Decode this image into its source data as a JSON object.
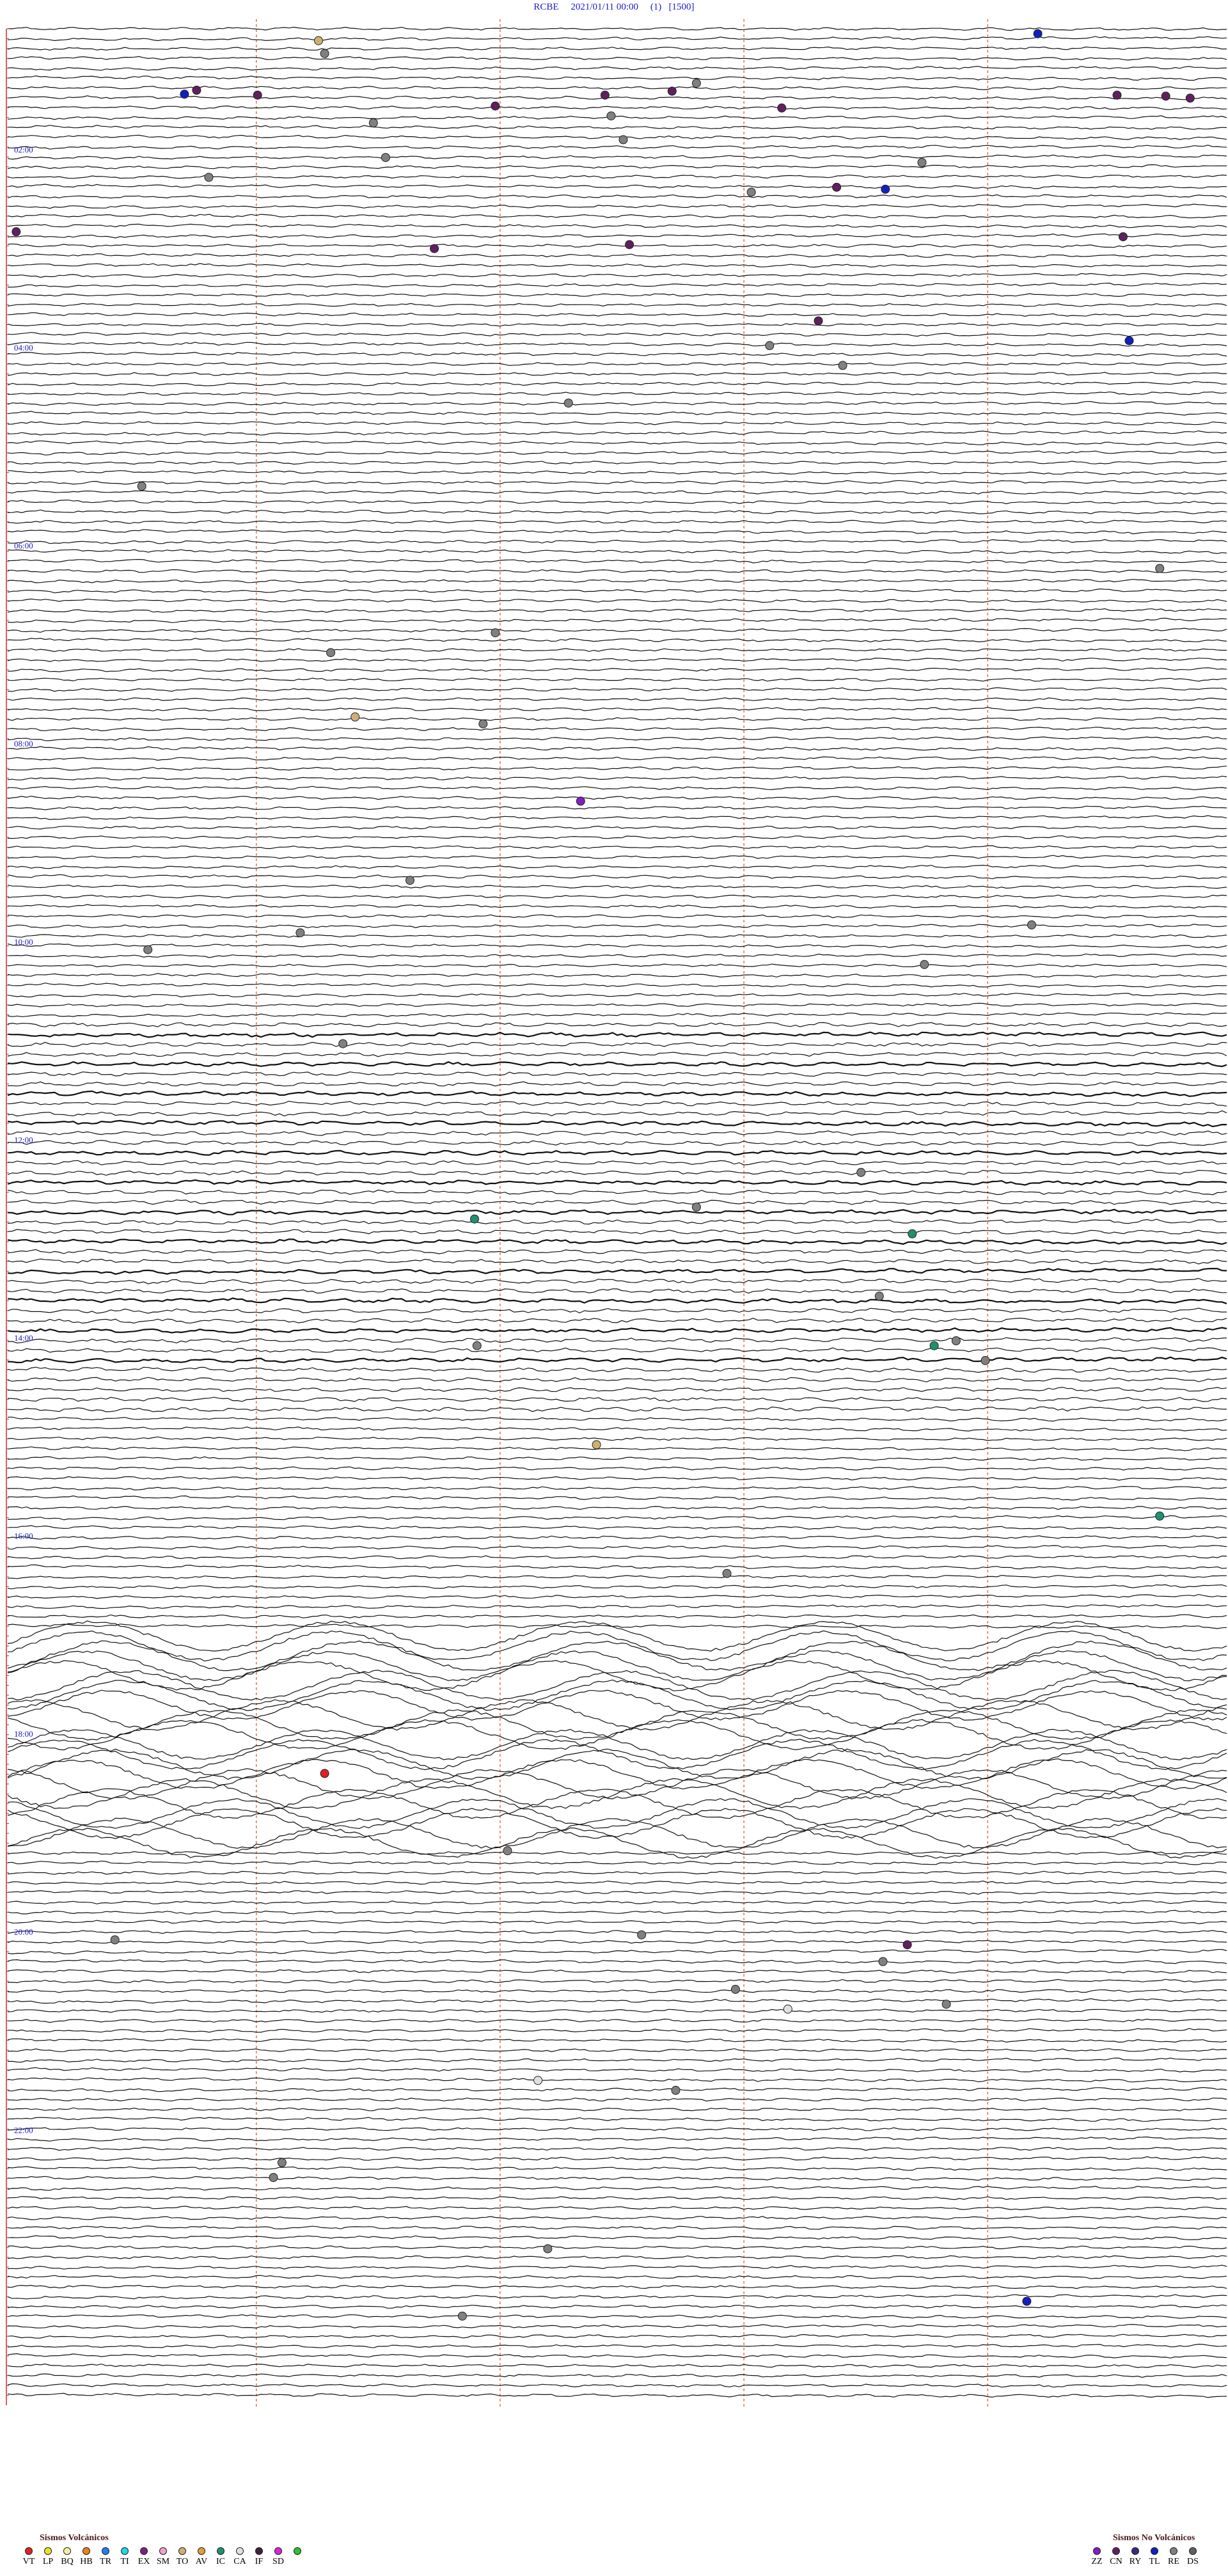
{
  "header": {
    "station": "RCBE",
    "datetime": "2021/01/11 00:00",
    "run": "(1)",
    "scale": "[1500]"
  },
  "hour_labels": [
    "02:00",
    "04:00",
    "06:00",
    "08:00",
    "10:00",
    "12:00",
    "14:00",
    "16:00",
    "18:00",
    "20:00",
    "22:00"
  ],
  "colors": {
    "trace": "#111111",
    "gridline": "#e06a3a",
    "hour_label": "#1a1acc",
    "bracket": "#c03030"
  },
  "legend_volcanic": {
    "title": "Sismos Volcánicos",
    "items": [
      {
        "code": "VT",
        "color": "#e02020"
      },
      {
        "code": "LP",
        "color": "#f0e020"
      },
      {
        "code": "BQ",
        "color": "#f8f0a0"
      },
      {
        "code": "HB",
        "color": "#f08020"
      },
      {
        "code": "TR",
        "color": "#2080f0"
      },
      {
        "code": "TI",
        "color": "#20d8e0"
      },
      {
        "code": "EX",
        "color": "#802080"
      },
      {
        "code": "SM",
        "color": "#f0a0d0"
      },
      {
        "code": "TO",
        "color": "#d0b070"
      },
      {
        "code": "AV",
        "color": "#e0a040"
      },
      {
        "code": "IC",
        "color": "#209070"
      },
      {
        "code": "CA",
        "color": "#e0e0e0"
      },
      {
        "code": "IF",
        "color": "#402040"
      },
      {
        "code": "SD",
        "color": "#e020e0"
      },
      {
        "code": "",
        "color": "#30c030"
      }
    ]
  },
  "legend_nonvolcanic": {
    "title": "Sismos No Volcánicos",
    "items": [
      {
        "code": "ZZ",
        "color": "#8020c0"
      },
      {
        "code": "CN",
        "color": "#602060"
      },
      {
        "code": "RY",
        "color": "#402880"
      },
      {
        "code": "TL",
        "color": "#1020c0"
      },
      {
        "code": "RE",
        "color": "#808080"
      },
      {
        "code": "DS",
        "color": "#606060"
      }
    ]
  },
  "events": [
    {
      "hour": 0.05,
      "x": 0.845,
      "color": "#1020c0"
    },
    {
      "hour": 0.12,
      "x": 0.255,
      "color": "#d0b070"
    },
    {
      "hour": 0.25,
      "x": 0.26,
      "color": "#808080"
    },
    {
      "hour": 0.55,
      "x": 0.565,
      "color": "#808080"
    },
    {
      "hour": 0.62,
      "x": 0.155,
      "color": "#602060"
    },
    {
      "hour": 0.66,
      "x": 0.145,
      "color": "#1020c0"
    },
    {
      "hour": 0.63,
      "x": 0.545,
      "color": "#602060"
    },
    {
      "hour": 0.67,
      "x": 0.205,
      "color": "#602060"
    },
    {
      "hour": 0.67,
      "x": 0.49,
      "color": "#602060"
    },
    {
      "hour": 0.67,
      "x": 0.91,
      "color": "#602060"
    },
    {
      "hour": 0.68,
      "x": 0.95,
      "color": "#602060"
    },
    {
      "hour": 0.7,
      "x": 0.97,
      "color": "#602060"
    },
    {
      "hour": 0.78,
      "x": 0.4,
      "color": "#602060"
    },
    {
      "hour": 0.8,
      "x": 0.635,
      "color": "#602060"
    },
    {
      "hour": 0.88,
      "x": 0.495,
      "color": "#808080"
    },
    {
      "hour": 0.95,
      "x": 0.3,
      "color": "#808080"
    },
    {
      "hour": 1.12,
      "x": 0.505,
      "color": "#808080"
    },
    {
      "hour": 1.3,
      "x": 0.31,
      "color": "#808080"
    },
    {
      "hour": 1.35,
      "x": 0.75,
      "color": "#808080"
    },
    {
      "hour": 1.5,
      "x": 0.165,
      "color": "#808080"
    },
    {
      "hour": 1.6,
      "x": 0.68,
      "color": "#602060"
    },
    {
      "hour": 1.62,
      "x": 0.72,
      "color": "#1020c0"
    },
    {
      "hour": 1.65,
      "x": 0.61,
      "color": "#808080"
    },
    {
      "hour": 2.05,
      "x": 0.007,
      "color": "#602060"
    },
    {
      "hour": 2.1,
      "x": 0.915,
      "color": "#602060"
    },
    {
      "hour": 2.18,
      "x": 0.51,
      "color": "#602060"
    },
    {
      "hour": 2.22,
      "x": 0.35,
      "color": "#602060"
    },
    {
      "hour": 2.95,
      "x": 0.665,
      "color": "#602060"
    },
    {
      "hour": 3.15,
      "x": 0.92,
      "color": "#1020c0"
    },
    {
      "hour": 3.2,
      "x": 0.625,
      "color": "#808080"
    },
    {
      "hour": 3.4,
      "x": 0.685,
      "color": "#808080"
    },
    {
      "hour": 3.78,
      "x": 0.46,
      "color": "#808080"
    },
    {
      "hour": 4.62,
      "x": 0.11,
      "color": "#808080"
    },
    {
      "hour": 5.45,
      "x": 0.945,
      "color": "#808080"
    },
    {
      "hour": 6.1,
      "x": 0.4,
      "color": "#808080"
    },
    {
      "hour": 6.3,
      "x": 0.265,
      "color": "#808080"
    },
    {
      "hour": 6.95,
      "x": 0.285,
      "color": "#d0b070"
    },
    {
      "hour": 7.02,
      "x": 0.39,
      "color": "#808080"
    },
    {
      "hour": 7.8,
      "x": 0.47,
      "color": "#8020c0"
    },
    {
      "hour": 8.6,
      "x": 0.33,
      "color": "#808080"
    },
    {
      "hour": 9.05,
      "x": 0.84,
      "color": "#808080"
    },
    {
      "hour": 9.13,
      "x": 0.24,
      "color": "#808080"
    },
    {
      "hour": 9.3,
      "x": 0.115,
      "color": "#808080"
    },
    {
      "hour": 9.45,
      "x": 0.752,
      "color": "#808080"
    },
    {
      "hour": 10.25,
      "x": 0.275,
      "color": "#808080"
    },
    {
      "hour": 11.55,
      "x": 0.7,
      "color": "#808080"
    },
    {
      "hour": 11.9,
      "x": 0.565,
      "color": "#808080"
    },
    {
      "hour": 12.02,
      "x": 0.383,
      "color": "#209070"
    },
    {
      "hour": 12.17,
      "x": 0.742,
      "color": "#209070"
    },
    {
      "hour": 12.8,
      "x": 0.715,
      "color": "#808080"
    },
    {
      "hour": 13.3,
      "x": 0.385,
      "color": "#808080"
    },
    {
      "hour": 13.3,
      "x": 0.76,
      "color": "#209070"
    },
    {
      "hour": 13.25,
      "x": 0.778,
      "color": "#808080"
    },
    {
      "hour": 13.45,
      "x": 0.802,
      "color": "#808080"
    },
    {
      "hour": 14.3,
      "x": 0.483,
      "color": "#d0b070"
    },
    {
      "hour": 15.02,
      "x": 0.945,
      "color": "#209070"
    },
    {
      "hour": 15.6,
      "x": 0.59,
      "color": "#808080"
    },
    {
      "hour": 17.62,
      "x": 0.26,
      "color": "#e02020"
    },
    {
      "hour": 18.4,
      "x": 0.41,
      "color": "#808080"
    },
    {
      "hour": 19.3,
      "x": 0.088,
      "color": "#808080"
    },
    {
      "hour": 19.25,
      "x": 0.52,
      "color": "#808080"
    },
    {
      "hour": 19.35,
      "x": 0.738,
      "color": "#602060"
    },
    {
      "hour": 19.52,
      "x": 0.718,
      "color": "#808080"
    },
    {
      "hour": 19.8,
      "x": 0.597,
      "color": "#808080"
    },
    {
      "hour": 19.95,
      "x": 0.77,
      "color": "#808080"
    },
    {
      "hour": 20.0,
      "x": 0.64,
      "color": "#e0e0e0"
    },
    {
      "hour": 20.72,
      "x": 0.435,
      "color": "#e0e0e0"
    },
    {
      "hour": 20.82,
      "x": 0.548,
      "color": "#808080"
    },
    {
      "hour": 21.55,
      "x": 0.225,
      "color": "#808080"
    },
    {
      "hour": 21.7,
      "x": 0.218,
      "color": "#808080"
    },
    {
      "hour": 22.42,
      "x": 0.443,
      "color": "#808080"
    },
    {
      "hour": 22.95,
      "x": 0.836,
      "color": "#1020c0"
    },
    {
      "hour": 23.1,
      "x": 0.373,
      "color": "#808080"
    }
  ]
}
